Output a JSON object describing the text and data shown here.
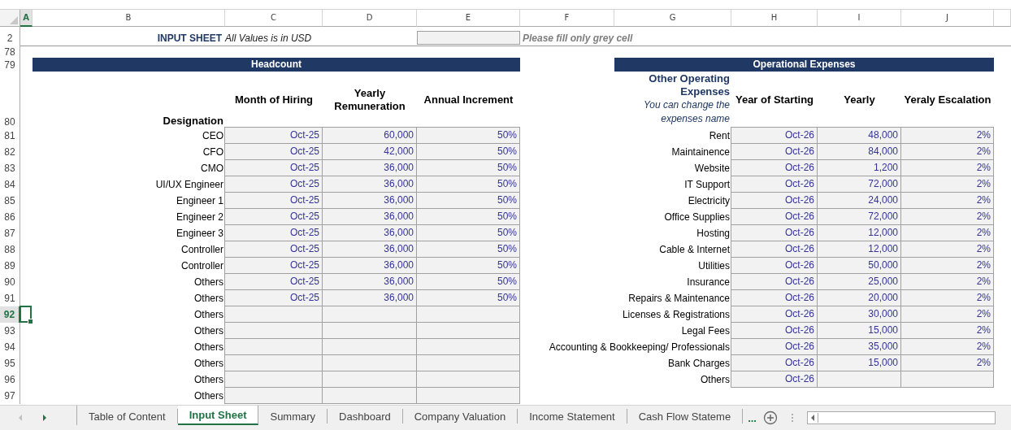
{
  "columns": [
    {
      "label": "A",
      "selected": true
    },
    {
      "label": "B",
      "selected": false
    },
    {
      "label": "C",
      "selected": false
    },
    {
      "label": "D",
      "selected": false
    },
    {
      "label": "E",
      "selected": false
    },
    {
      "label": "F",
      "selected": false
    },
    {
      "label": "G",
      "selected": false
    },
    {
      "label": "H",
      "selected": false
    },
    {
      "label": "I",
      "selected": false
    },
    {
      "label": "J",
      "selected": false
    }
  ],
  "row_numbers": {
    "title": "2",
    "spacer": "78",
    "band": "79",
    "header": "80"
  },
  "sheet_title": "INPUT SHEET",
  "currency_note": "All Values is in USD",
  "fill_hint": "Please fill only grey cell",
  "headcount": {
    "title": "Headcount",
    "designation_header": "Designation",
    "headers": [
      "Month of Hiring",
      "Yearly Remuneration",
      "Annual Increment"
    ],
    "rows": [
      {
        "row": "81",
        "selected": false,
        "designation": "CEO",
        "month": "Oct-25",
        "remuneration": "60,000",
        "increment": "50%"
      },
      {
        "row": "82",
        "selected": false,
        "designation": "CFO",
        "month": "Oct-25",
        "remuneration": "42,000",
        "increment": "50%"
      },
      {
        "row": "83",
        "selected": false,
        "designation": "CMO",
        "month": "Oct-25",
        "remuneration": "36,000",
        "increment": "50%"
      },
      {
        "row": "84",
        "selected": false,
        "designation": "UI/UX Engineer",
        "month": "Oct-25",
        "remuneration": "36,000",
        "increment": "50%"
      },
      {
        "row": "85",
        "selected": false,
        "designation": "Engineer 1",
        "month": "Oct-25",
        "remuneration": "36,000",
        "increment": "50%"
      },
      {
        "row": "86",
        "selected": false,
        "designation": "Engineer 2",
        "month": "Oct-25",
        "remuneration": "36,000",
        "increment": "50%"
      },
      {
        "row": "87",
        "selected": false,
        "designation": "Engineer 3",
        "month": "Oct-25",
        "remuneration": "36,000",
        "increment": "50%"
      },
      {
        "row": "88",
        "selected": false,
        "designation": "Controller",
        "month": "Oct-25",
        "remuneration": "36,000",
        "increment": "50%"
      },
      {
        "row": "89",
        "selected": false,
        "designation": "Controller",
        "month": "Oct-25",
        "remuneration": "36,000",
        "increment": "50%"
      },
      {
        "row": "90",
        "selected": false,
        "designation": "Others",
        "month": "Oct-25",
        "remuneration": "36,000",
        "increment": "50%"
      },
      {
        "row": "91",
        "selected": false,
        "designation": "Others",
        "month": "Oct-25",
        "remuneration": "36,000",
        "increment": "50%"
      },
      {
        "row": "92",
        "selected": true,
        "designation": "Others"
      },
      {
        "row": "93",
        "selected": false,
        "designation": "Others"
      },
      {
        "row": "94",
        "selected": false,
        "designation": "Others"
      },
      {
        "row": "95",
        "selected": false,
        "designation": "Others"
      },
      {
        "row": "96",
        "selected": false,
        "designation": "Others"
      },
      {
        "row": "97",
        "selected": false,
        "designation": "Others"
      }
    ]
  },
  "operational_expenses": {
    "title": "Operational Expenses",
    "name_header": "Other Operating Expenses",
    "name_hint": "You can change the expenses name",
    "headers": [
      "Year of Starting",
      "Yearly",
      "Yeraly Escalation"
    ],
    "rows": [
      {
        "name": "Rent",
        "start": "Oct-26",
        "yearly": "48,000",
        "escalation": "2%"
      },
      {
        "name": "Maintainence",
        "start": "Oct-26",
        "yearly": "84,000",
        "escalation": "2%"
      },
      {
        "name": "Website",
        "start": "Oct-26",
        "yearly": "1,200",
        "escalation": "2%"
      },
      {
        "name": "IT Support",
        "start": "Oct-26",
        "yearly": "72,000",
        "escalation": "2%"
      },
      {
        "name": "Electricity",
        "start": "Oct-26",
        "yearly": "24,000",
        "escalation": "2%"
      },
      {
        "name": "Office Supplies",
        "start": "Oct-26",
        "yearly": "72,000",
        "escalation": "2%"
      },
      {
        "name": "Hosting",
        "start": "Oct-26",
        "yearly": "12,000",
        "escalation": "2%"
      },
      {
        "name": "Cable & Internet",
        "start": "Oct-26",
        "yearly": "12,000",
        "escalation": "2%"
      },
      {
        "name": "Utilities",
        "start": "Oct-26",
        "yearly": "50,000",
        "escalation": "2%"
      },
      {
        "name": "Insurance",
        "start": "Oct-26",
        "yearly": "25,000",
        "escalation": "2%"
      },
      {
        "name": "Repairs & Maintenance",
        "start": "Oct-26",
        "yearly": "20,000",
        "escalation": "2%"
      },
      {
        "name": "Licenses & Registrations",
        "start": "Oct-26",
        "yearly": "30,000",
        "escalation": "2%"
      },
      {
        "name": "Legal Fees",
        "start": "Oct-26",
        "yearly": "15,000",
        "escalation": "2%"
      },
      {
        "name": "Accounting & Bookkeeping/ Professionals",
        "start": "Oct-26",
        "yearly": "35,000",
        "escalation": "2%"
      },
      {
        "name": "Bank Charges",
        "start": "Oct-26",
        "yearly": "15,000",
        "escalation": "2%"
      },
      {
        "name": "Others",
        "start": "Oct-26"
      }
    ]
  },
  "sheet_tabs": [
    {
      "label": "Table of Content",
      "selected": false
    },
    {
      "label": "Input Sheet",
      "selected": true
    },
    {
      "label": "Summary",
      "selected": false
    },
    {
      "label": "Dashboard",
      "selected": false
    },
    {
      "label": "Company Valuation",
      "selected": false
    },
    {
      "label": "Income Statement",
      "selected": false
    },
    {
      "label": "Cash Flow Stateme",
      "selected": false
    }
  ],
  "more_tabs": "..."
}
